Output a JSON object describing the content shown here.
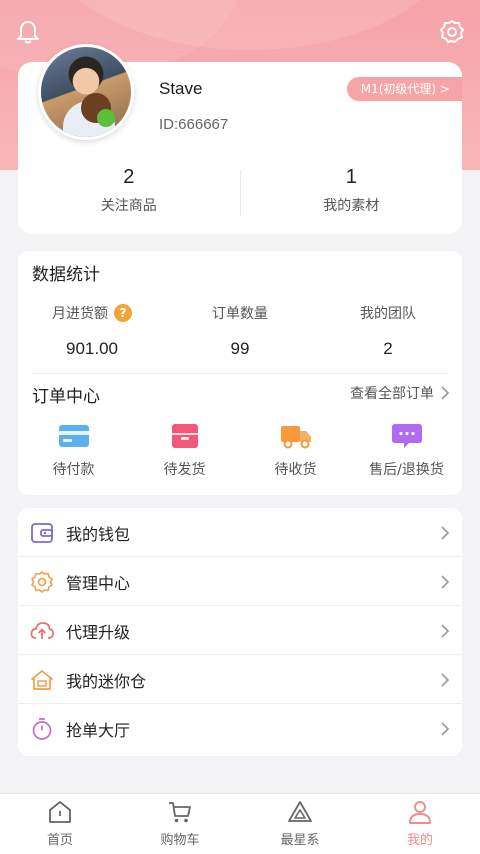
{
  "header": {
    "icons": [
      "bell-icon",
      "settings-icon"
    ]
  },
  "profile": {
    "name": "Stave",
    "id_text": "ID:666667",
    "level_badge": "M1(初级代理) >",
    "stats": [
      {
        "value": "2",
        "label": "关注商品"
      },
      {
        "value": "1",
        "label": "我的素材"
      }
    ]
  },
  "data_stats": {
    "title": "数据统计",
    "items": [
      {
        "label": "月进货额",
        "value": "901.00",
        "help": "?"
      },
      {
        "label": "订单数量",
        "value": "99"
      },
      {
        "label": "我的团队",
        "value": "2"
      }
    ]
  },
  "order_center": {
    "title": "订单中心",
    "view_all": "查看全部订单",
    "items": [
      {
        "label": "待付款",
        "icon": "card-icon",
        "color": "#5ab1ee"
      },
      {
        "label": "待发货",
        "icon": "box-icon",
        "color": "#f2577a"
      },
      {
        "label": "待收货",
        "icon": "truck-icon",
        "color": "#f89a3c"
      },
      {
        "label": "售后/退换货",
        "icon": "chat-icon",
        "color": "#b06bf0"
      }
    ]
  },
  "menu": [
    {
      "label": "我的钱包",
      "icon": "wallet-icon",
      "color": "#7a6fc9"
    },
    {
      "label": "管理中心",
      "icon": "gear-icon",
      "color": "#f0a04a"
    },
    {
      "label": "代理升级",
      "icon": "upload-cloud-icon",
      "color": "#ee6f6f"
    },
    {
      "label": "我的迷你仓",
      "icon": "house-icon",
      "color": "#f0a04a"
    },
    {
      "label": "抢单大厅",
      "icon": "timer-icon",
      "color": "#c46fc4"
    }
  ],
  "tabbar": [
    {
      "label": "首页",
      "icon": "home-icon",
      "active": false
    },
    {
      "label": "购物车",
      "icon": "cart-icon",
      "active": false
    },
    {
      "label": "最星系",
      "icon": "triangle-icon",
      "active": false
    },
    {
      "label": "我的",
      "icon": "person-icon",
      "active": true
    }
  ],
  "colors": {
    "accent": "#f08c8f",
    "hero": "#f7a8ab",
    "background": "#f3f3f5"
  }
}
